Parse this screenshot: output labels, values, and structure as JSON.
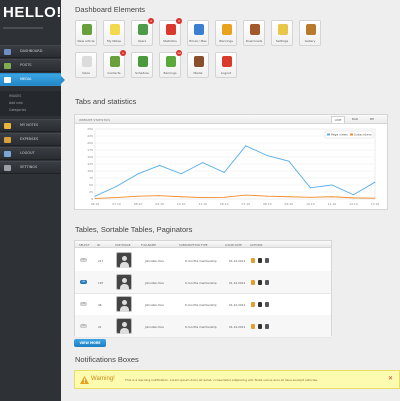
{
  "app": {
    "logo": "HELLO!"
  },
  "sidebar": {
    "items": [
      {
        "label": "DASHBOARD",
        "icon": "dashboard-icon",
        "color": "#6f8fc4"
      },
      {
        "label": "POSTS",
        "icon": "posts-icon",
        "color": "#7fae4f"
      },
      {
        "label": "MEDIA",
        "icon": "media-icon",
        "color": "#ffffff",
        "active": true
      },
      {
        "label": "MY NOTES",
        "icon": "notes-icon",
        "color": "#e7b63a"
      },
      {
        "label": "EXPENSES",
        "icon": "expenses-icon",
        "color": "#d9a13c"
      },
      {
        "label": "LOGOUT",
        "icon": "logout-icon",
        "color": "#7aa6d6"
      },
      {
        "label": "SETTINGS",
        "icon": "settings-icon",
        "color": "#9aa0a6"
      }
    ],
    "subitems": [
      "IMAGES",
      "Add new",
      "Categories"
    ]
  },
  "sections": {
    "dashboard": "Dashboard Elements",
    "stats": "Tabs and statistics",
    "tables": "Tables, Sortable Tables, Paginators",
    "notifications": "Notifications Boxes"
  },
  "tiles": [
    {
      "label": "New article",
      "icon": "pencil-icon",
      "color": "#6aa03c"
    },
    {
      "label": "My Notes",
      "icon": "notes-icon",
      "color": "#f2d84b"
    },
    {
      "label": "Users",
      "icon": "users-icon",
      "color": "#4f9b4a",
      "badge": "4"
    },
    {
      "label": "Statistics",
      "icon": "statistics-icon",
      "color": "#d93a2b",
      "badge": "2"
    },
    {
      "label": "Email / Mes",
      "icon": "monitor-icon",
      "color": "#3b7fd2"
    },
    {
      "label": "Warnings",
      "icon": "warning-icon",
      "color": "#e9a21b"
    },
    {
      "label": "Downloads",
      "icon": "downloads-icon",
      "color": "#a35a2a"
    },
    {
      "label": "Settings",
      "icon": "settings-icon",
      "color": "#e8c64a"
    },
    {
      "label": "Gallery",
      "icon": "gallery-icon",
      "color": "#b77a2c"
    },
    {
      "label": "Inbox",
      "icon": "inbox-icon",
      "color": "#dcdcdc"
    },
    {
      "label": "Contacts",
      "icon": "contacts-icon",
      "color": "#6aa03c",
      "badge": "1"
    },
    {
      "label": "Schedule",
      "icon": "schedule-icon",
      "color": "#4a9a3c"
    },
    {
      "label": "Earnings",
      "icon": "earnings-icon",
      "color": "#5aa83c",
      "badge": "12"
    },
    {
      "label": "Media",
      "icon": "film-icon",
      "color": "#8a4f2a"
    },
    {
      "label": "Logout",
      "icon": "logout-icon",
      "color": "#d93a2b"
    }
  ],
  "chart_panel": {
    "title": "WEBSITE STATISTICS",
    "tabs": [
      "LINE",
      "BAR",
      "PIE"
    ],
    "active_tab": "LINE"
  },
  "chart_data": {
    "type": "line",
    "title": "",
    "x": [
      "06.10",
      "07.10",
      "08.10",
      "09.10",
      "10.10",
      "11.10",
      "06.10",
      "07.10",
      "08.10",
      "09.10",
      "10.10",
      "11.10",
      "12.10",
      "13.10"
    ],
    "series": [
      {
        "name": "Page views",
        "color": "#59aee8",
        "values": [
          10,
          45,
          90,
          120,
          90,
          130,
          95,
          190,
          155,
          135,
          40,
          50,
          15,
          60
        ]
      },
      {
        "name": "Subscribers",
        "color": "#f08a2c",
        "values": [
          2,
          5,
          10,
          12,
          8,
          5,
          6,
          14,
          10,
          8,
          6,
          8,
          4,
          3
        ]
      }
    ],
    "ylim": [
      0,
      250
    ],
    "yticks": [
      0,
      25,
      50,
      75,
      100,
      125,
      150,
      175,
      200,
      225,
      250
    ],
    "grid": true,
    "legend": "top-right"
  },
  "table": {
    "headers": [
      "SELECT",
      "ID",
      "USE IMAGE",
      "FULLNAME",
      "SUBSCRIPTION TYPE",
      "LOGIN DATE",
      "ACTIONS"
    ],
    "rows": [
      {
        "selected": false,
        "toggle": "OFF",
        "id": "217",
        "name": "Johnatan Doe",
        "type": "6 months membership",
        "date": "01-12-2011"
      },
      {
        "selected": true,
        "toggle": "ON",
        "id": "197",
        "name": "Johnatan Doe",
        "type": "6 months membership",
        "date": "01-12-2011"
      },
      {
        "selected": false,
        "toggle": "OFF",
        "id": "46",
        "name": "Johnatan Doe",
        "type": "6 months membership",
        "date": "01-12-2011"
      },
      {
        "selected": false,
        "toggle": "OFF",
        "id": "21",
        "name": "Johnatan Doe",
        "type": "6 months membership",
        "date": "01-12-2011"
      }
    ],
    "view_more": "VIEW MORE"
  },
  "notification": {
    "title": "Warning!",
    "text": "This is a warning notification. Lorem ipsum dolor sit amet, consectetur adipiscing elit. Nulla varius eros et risus suscipit ultricies.",
    "close": "✕"
  }
}
